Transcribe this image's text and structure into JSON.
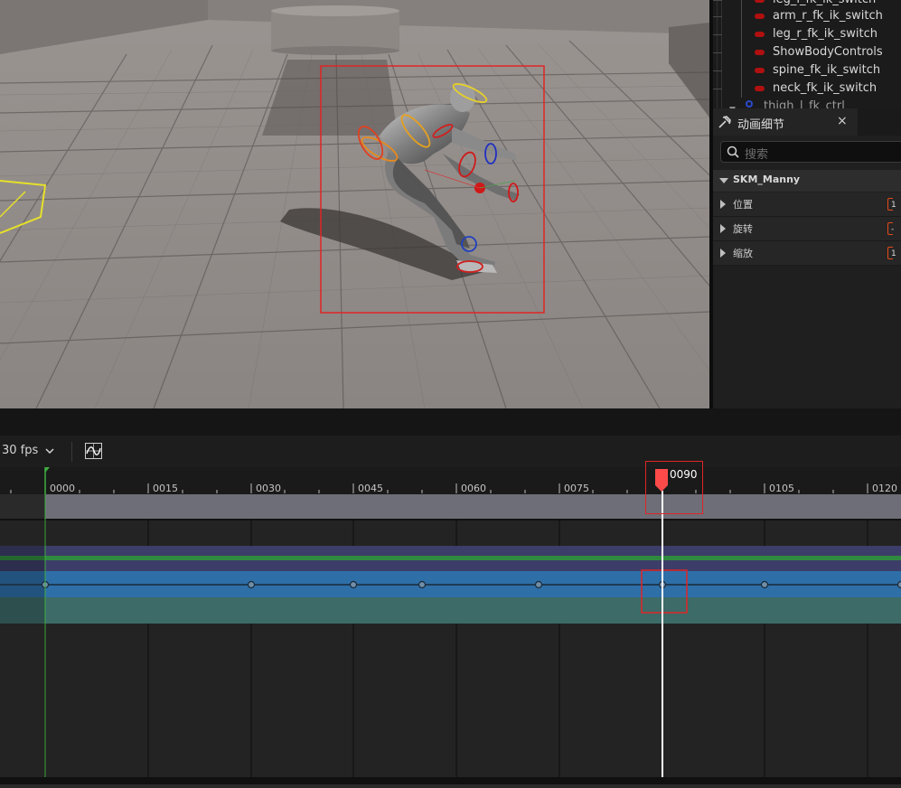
{
  "outliner": {
    "items": [
      {
        "label": "leg_l_fk_ik_switch"
      },
      {
        "label": "arm_r_fk_ik_switch"
      },
      {
        "label": "leg_r_fk_ik_switch"
      },
      {
        "label": "ShowBodyControls"
      },
      {
        "label": "spine_fk_ik_switch"
      },
      {
        "label": "neck_fk_ik_switch"
      }
    ],
    "partial_item": "thigh_l_fk_ctrl"
  },
  "details": {
    "tab_title": "动画细节",
    "close_glyph": "×",
    "search_placeholder": "搜索",
    "category": "SKM_Manny",
    "properties": [
      {
        "label": "位置",
        "value": "1"
      },
      {
        "label": "旋转",
        "value": "-"
      },
      {
        "label": "缩放",
        "value": "1"
      }
    ]
  },
  "timeline": {
    "fps": "30 fps",
    "playhead_frame": "0090",
    "ruler_labels": [
      "0000",
      "0015",
      "0030",
      "0045",
      "0060",
      "0075",
      "0105",
      "0120"
    ],
    "keyframes": [
      0,
      30,
      45,
      55,
      72,
      90,
      105,
      125
    ]
  },
  "colors": {
    "accent_red": "#e03030",
    "playhead": "#ff4a4a",
    "track_blue": "#2e6fa8",
    "track_teal": "#3c6b68",
    "track_purple": "#3c3d68",
    "track_green": "#2f8a3f",
    "section_gray": "#6e6e78"
  }
}
